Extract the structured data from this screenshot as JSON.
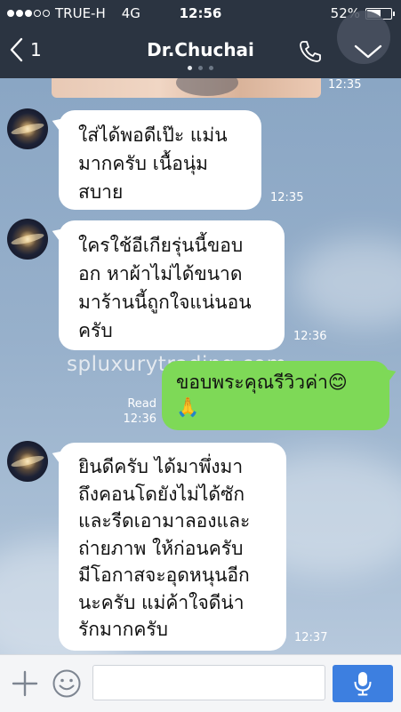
{
  "status_bar": {
    "carrier": "TRUE-H",
    "network": "4G",
    "time": "12:56",
    "battery_percent": "52%",
    "battery_level": 0.52,
    "signal_bars_filled": 3,
    "signal_bars_total": 5
  },
  "header": {
    "back_count": "1",
    "title": "Dr.Chuchai",
    "page_index": 0,
    "page_count": 3,
    "icons": [
      "chevron-left-icon",
      "phone-icon",
      "chevron-down-icon"
    ],
    "bg_color": "#2b3441"
  },
  "chat": {
    "photo_time": "12:35",
    "messages": [
      {
        "direction": "incoming",
        "lines": [
          "ใส่ได้พอดีเป๊ะ แม่น",
          "มากครับ เนื้อนุ่ม",
          "สบาย"
        ],
        "time": "12:35"
      },
      {
        "direction": "incoming",
        "lines": [
          "ใครใช้อีเกียรุ่นนี้ขอบ",
          "อก หาผ้าไม่ได้ขนาด",
          "มาร้านนี้ถูกใจแน่นอน",
          "ครับ"
        ],
        "time": "12:36"
      },
      {
        "direction": "outgoing",
        "lines": [
          "ขอบพระคุณรีวิวค่า😊",
          "🙏"
        ],
        "read_label": "Read",
        "time": "12:36"
      },
      {
        "direction": "incoming",
        "lines": [
          "ยินดีครับ ได้มาพึ่งมา",
          "ถึงคอนโดยังไม่ได้ซัก",
          "และรีดเอามาลองและ",
          "ถ่ายภาพ ให้ก่อนครับ",
          "มีโอกาสจะอุดหนุนอีก",
          "นะครับ แม่ค้าใจดีน่า",
          "รักมากครับ"
        ],
        "time": "12:37"
      }
    ],
    "watermark": "spluxurytrading.com",
    "incoming_bubble_color": "#ffffff",
    "outgoing_bubble_color": "#7ed957"
  },
  "input_bar": {
    "placeholder": "",
    "icons": [
      "plus-icon",
      "emoji-icon",
      "microphone-icon"
    ],
    "mic_color": "#3d7fe0"
  }
}
